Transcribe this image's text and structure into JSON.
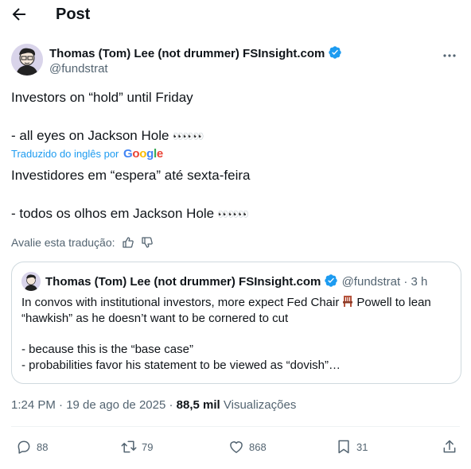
{
  "header": {
    "title": "Post"
  },
  "author": {
    "name": "Thomas (Tom) Lee (not drummer) FSInsight.com",
    "handle": "@fundstrat"
  },
  "tweet": {
    "line1": "Investors on “hold” until Friday",
    "line2": "- all eyes on Jackson Hole",
    "eyes": "👀👀👀",
    "translated_label": "Traduzido do inglês por",
    "translator": "Google",
    "tline1": "Investidores em “espera” até sexta-feira",
    "tline2": "- todos os olhos em Jackson Hole",
    "teyes": "👀👀👀",
    "rate_label": "Avalie esta tradução:"
  },
  "quote": {
    "name": "Thomas (Tom) Lee (not drummer) FSInsight.com",
    "handle": "@fundstrat",
    "time": "· 3 h",
    "line1a": "In convos with institutional investors, more expect Fed Chair",
    "line1b": "Powell to lean",
    "line2": "“hawkish” as he doesn’t want to be cornered to cut",
    "line3": "- because this is the “base case”",
    "line4": "- probabilities favor his statement to be viewed as “dovish”…"
  },
  "meta": {
    "time": "1:24 PM · 19 de ago de 2025 ·",
    "views": "88,5 mil",
    "views_label": "Visualizações"
  },
  "actions": {
    "replies": "88",
    "reposts": "79",
    "likes": "868",
    "bookmarks": "31"
  },
  "colors": {
    "accent": "#1d9bf0",
    "muted": "#536471",
    "text": "#0f1419",
    "border": "#cfd9de"
  }
}
